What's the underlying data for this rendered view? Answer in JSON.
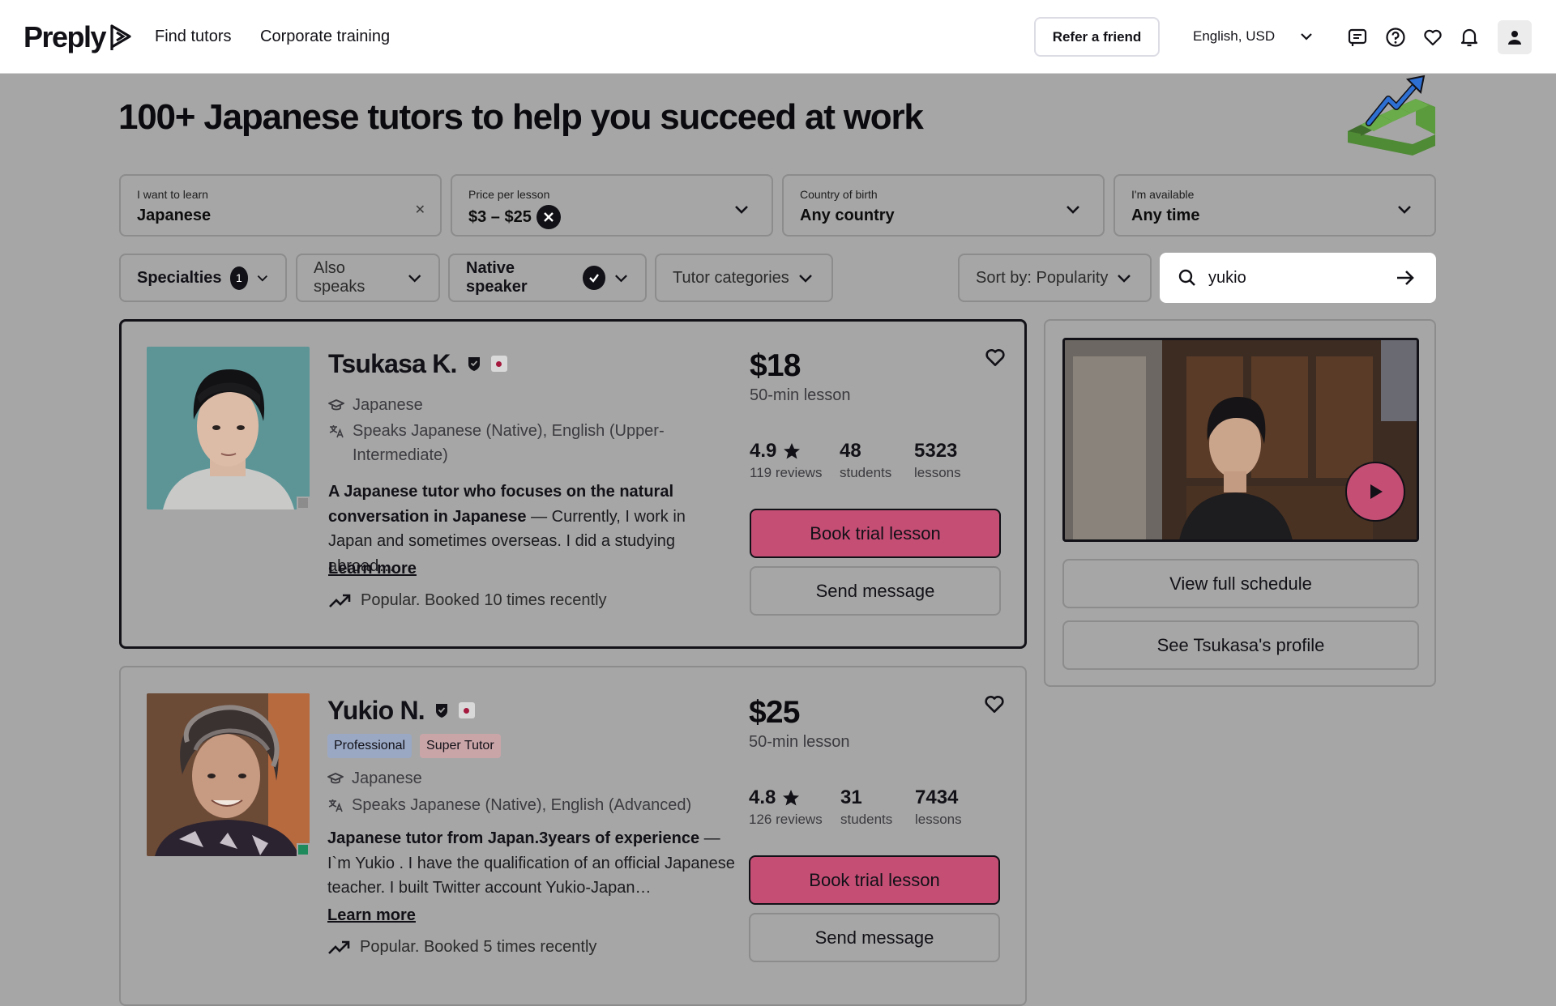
{
  "header": {
    "logo_text": "Preply",
    "nav": {
      "find_tutors": "Find tutors",
      "corporate_training": "Corporate training"
    },
    "refer_button": "Refer a friend",
    "locale": "English, USD",
    "icons": [
      "messages-icon",
      "help-icon",
      "heart-icon",
      "bell-icon",
      "user-icon"
    ]
  },
  "hero": {
    "title": "100+ Japanese tutors to help you succeed at work"
  },
  "filters": {
    "learn": {
      "label": "I want to learn",
      "value": "Japanese"
    },
    "price": {
      "label": "Price per lesson",
      "value": "$3 – $25"
    },
    "country": {
      "label": "Country of birth",
      "value": "Any country"
    },
    "availability": {
      "label": "I'm available",
      "value": "Any time"
    }
  },
  "chips": {
    "specialties": "Specialties",
    "specialties_count": "1",
    "also_speaks": "Also speaks",
    "native_speaker": "Native speaker",
    "tutor_categories": "Tutor categories",
    "sort": "Sort by: Popularity"
  },
  "search": {
    "value": "yukio"
  },
  "tutors": [
    {
      "name": "Tsukasa K.",
      "subject": "Japanese",
      "speaks": "Speaks Japanese (Native), English (Upper-Intermediate)",
      "headline": "A Japanese tutor who focuses on the natural conversation in Japanese",
      "description": " — Currently, I work in Japan and sometimes overseas. I did a studying abroad…",
      "learn_more": "Learn more",
      "popular": "Popular. Booked 10 times recently",
      "price": "$18",
      "duration": "50-min lesson",
      "rating": "4.9",
      "reviews": "119 reviews",
      "students": "48",
      "students_label": "students",
      "lessons": "5323",
      "lessons_label": "lessons",
      "book": "Book trial lesson",
      "message": "Send message"
    },
    {
      "name": "Yukio N.",
      "badges": [
        "Professional",
        "Super Tutor"
      ],
      "subject": "Japanese",
      "speaks": "Speaks Japanese (Native), English (Advanced)",
      "headline": "Japanese tutor from Japan.3years of experience",
      "description": " — I`m Yukio . I have the qualification of an official Japanese teacher. I built Twitter account Yukio-Japan…",
      "learn_more": "Learn more",
      "popular": "Popular. Booked 5 times recently",
      "price": "$25",
      "duration": "50-min lesson",
      "rating": "4.8",
      "reviews": "126 reviews",
      "students": "31",
      "students_label": "students",
      "lessons": "7434",
      "lessons_label": "lessons",
      "book": "Book trial lesson",
      "message": "Send message"
    }
  ],
  "side_panel": {
    "view_schedule": "View full schedule",
    "see_profile": "See Tsukasa's profile"
  },
  "colors": {
    "brand_pink": "#c54e75",
    "overlay_gray": "#a6a6a6",
    "text_dark": "#121117"
  }
}
